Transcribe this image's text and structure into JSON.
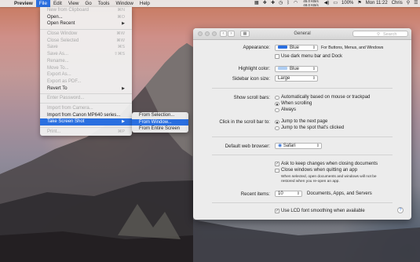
{
  "menubar": {
    "apple_icon": "apple-icon",
    "items": [
      "Preview",
      "File",
      "Edit",
      "View",
      "Go",
      "Tools",
      "Window",
      "Help"
    ],
    "status": {
      "time": "Mon 11:22",
      "user": "Chris",
      "cpu_line1": "45.0 KB/s",
      "cpu_line2": "48.0 KB/s",
      "battery_percent": "100%"
    }
  },
  "file_menu": {
    "items": [
      {
        "label": "New from Clipboard",
        "shortcut": "⌘N",
        "disabled": true
      },
      {
        "label": "Open...",
        "shortcut": "⌘O",
        "disabled": false
      },
      {
        "label": "Open Recent",
        "shortcut": "▶",
        "disabled": false
      },
      {
        "sep": true
      },
      {
        "label": "Close Window",
        "shortcut": "⌘W",
        "disabled": true
      },
      {
        "label": "Close Selected",
        "shortcut": "⌘W",
        "disabled": true
      },
      {
        "label": "Save",
        "shortcut": "⌘S",
        "disabled": true
      },
      {
        "label": "Save As...",
        "shortcut": "⇧⌘S",
        "disabled": true
      },
      {
        "label": "Rename...",
        "shortcut": "",
        "disabled": true
      },
      {
        "label": "Move To...",
        "shortcut": "",
        "disabled": true
      },
      {
        "label": "Export As...",
        "shortcut": "",
        "disabled": true
      },
      {
        "label": "Export as PDF...",
        "shortcut": "",
        "disabled": true
      },
      {
        "label": "Revert To",
        "shortcut": "▶",
        "disabled": false
      },
      {
        "sep": true
      },
      {
        "label": "Enter Password...",
        "shortcut": "",
        "disabled": true
      },
      {
        "sep": true
      },
      {
        "label": "Import from Camera...",
        "shortcut": "",
        "disabled": true
      },
      {
        "label": "Import from Canon MP640 series...",
        "shortcut": "",
        "disabled": false
      },
      {
        "label": "Take Screen Shot",
        "shortcut": "▶",
        "disabled": false,
        "selected": true
      },
      {
        "sep": true
      },
      {
        "label": "Print...",
        "shortcut": "⌘P",
        "disabled": true
      }
    ]
  },
  "submenu": {
    "items": [
      {
        "label": "From Selection...",
        "selected": false
      },
      {
        "label": "From Window...",
        "selected": true
      },
      {
        "label": "From Entire Screen",
        "selected": false
      }
    ]
  },
  "prefs": {
    "title": "General",
    "search_placeholder": "Search",
    "appearance_label": "Appearance:",
    "appearance_value": "Blue",
    "appearance_note": "For Buttons, Menus, and Windows",
    "dark_menu_label": "Use dark menu bar and Dock",
    "highlight_label": "Highlight color:",
    "highlight_value": "Blue",
    "sidebar_label": "Sidebar icon size:",
    "sidebar_value": "Large",
    "scroll_label": "Show scroll bars:",
    "scroll_opt1": "Automatically based on mouse or trackpad",
    "scroll_opt2": "When scrolling",
    "scroll_opt3": "Always",
    "click_label": "Click in the scroll bar to:",
    "click_opt1": "Jump to the next page",
    "click_opt2": "Jump to the spot that's clicked",
    "browser_label": "Default web browser:",
    "browser_value": "Safari",
    "ask_keep_label": "Ask to keep changes when closing documents",
    "close_windows_label": "Close windows when quitting an app",
    "close_windows_note1": "When selected, open documents and windows will not be",
    "close_windows_note2": "restored when you re-open an app.",
    "recent_label": "Recent items:",
    "recent_value": "10",
    "recent_note": "Documents, Apps, and Servers",
    "lcd_label": "Use LCD font smoothing when available",
    "help_glyph": "?",
    "accent_color": "#2a6fe0"
  }
}
